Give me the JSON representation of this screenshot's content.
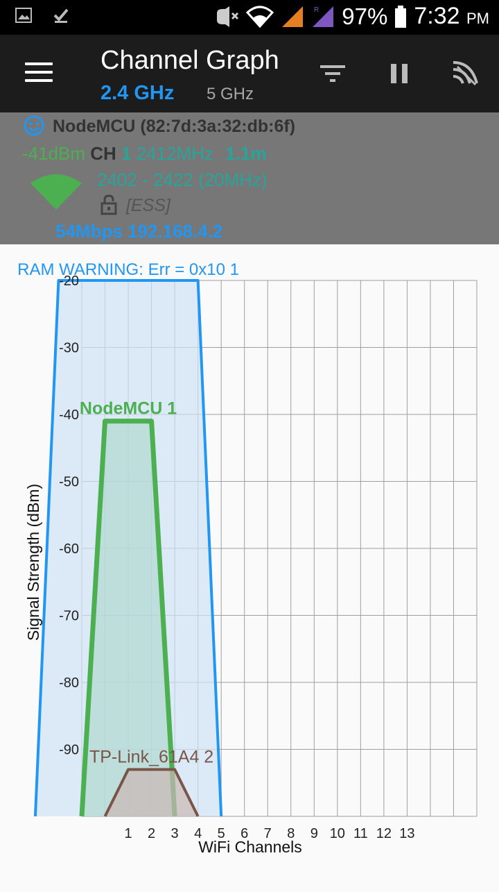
{
  "status_bar": {
    "battery": "97%",
    "time": "7:32",
    "ampm": "PM",
    "icons": [
      "gallery-icon",
      "download-check-icon",
      "mute-icon",
      "wifi-icon",
      "signal-icon",
      "signal-roaming-icon",
      "battery-icon"
    ]
  },
  "appbar": {
    "title": "Channel Graph",
    "tab_active": "2.4 GHz",
    "tab_inactive": "5 GHz",
    "icons": [
      "menu-icon",
      "filter-icon",
      "pause-icon",
      "wifi-scan-icon"
    ]
  },
  "connected": {
    "ssid_mac": "NodeMCU (82:7d:3a:32:db:6f)",
    "signal": "-41dBm",
    "ch_label": "CH",
    "ch_value": "1",
    "frequency": "2412MHz",
    "distance": "1.1m",
    "range": "2402 - 2422 (20MHz)",
    "security": "[ESS]",
    "speed_ip": "54Mbps 192.168.4.2",
    "colors": {
      "green": "#4caf50",
      "teal": "#26a69a",
      "blue": "#2196f3"
    }
  },
  "chart_data": {
    "type": "area",
    "truncated_label": "RAM WARNING: Err = 0x10 1",
    "xlabel": "WiFi Channels",
    "ylabel": "Signal Strength (dBm)",
    "x_ticks": [
      "1",
      "2",
      "3",
      "4",
      "5",
      "6",
      "7",
      "8",
      "9",
      "10",
      "11",
      "12",
      "13"
    ],
    "y_ticks": [
      "-20",
      "-30",
      "-40",
      "-50",
      "-60",
      "-70",
      "-80",
      "-90"
    ],
    "ylim": [
      -100,
      -20
    ],
    "xlim": [
      -1,
      16
    ],
    "series": [
      {
        "name": "RAM WARNING: Err = 0x10 1",
        "channel": 1,
        "width_mhz": 40,
        "signal": -20,
        "color": "#2196f3",
        "fill": "#cfe3f6"
      },
      {
        "name": "NodeMCU 1",
        "channel": 1,
        "width_mhz": 20,
        "signal": -41,
        "color": "#4caf50",
        "fill": "#b0d8d0"
      },
      {
        "name": "TP-Link_61A4 2",
        "channel": 2,
        "width_mhz": 20,
        "signal": -93,
        "color": "#795548",
        "fill": "#c9b8b3"
      }
    ]
  }
}
